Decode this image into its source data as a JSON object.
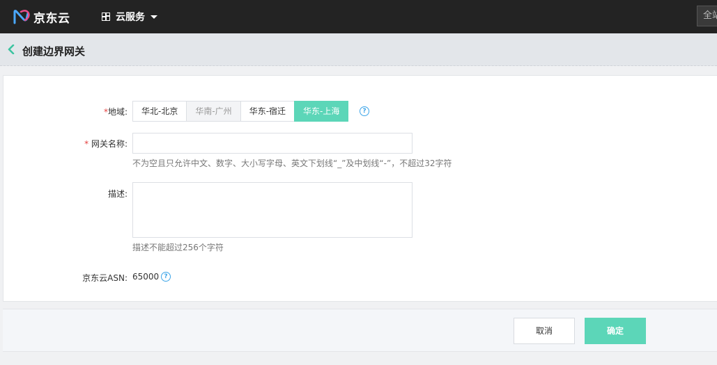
{
  "topbar": {
    "brand": "京东云",
    "cloud_menu_label": "云服务",
    "search_placeholder": "全站"
  },
  "header": {
    "title": "创建边界网关"
  },
  "form": {
    "region": {
      "label": "地域:",
      "required_mark": "*",
      "options": [
        {
          "label": "华北-北京",
          "state": "normal"
        },
        {
          "label": "华南-广州",
          "state": "disabled"
        },
        {
          "label": "华东-宿迁",
          "state": "normal"
        },
        {
          "label": "华东-上海",
          "state": "selected"
        }
      ],
      "help_icon": "question-circle-icon"
    },
    "name": {
      "label": "网关名称:",
      "required_mark": "*",
      "value": "",
      "hint": "不为空且只允许中文、数字、大小写字母、英文下划线“_”及中划线“-”，不超过32字符"
    },
    "description": {
      "label": "描述:",
      "value": "",
      "hint": "描述不能超过256个字符"
    },
    "asn": {
      "label": "京东云ASN:",
      "value": "65000",
      "help_icon": "question-circle-icon"
    }
  },
  "footer": {
    "cancel_label": "取消",
    "confirm_label": "确定"
  },
  "colors": {
    "accent": "#5cd6b8",
    "topbar": "#232323",
    "required": "#e5403f",
    "help": "#3ba4e8"
  }
}
